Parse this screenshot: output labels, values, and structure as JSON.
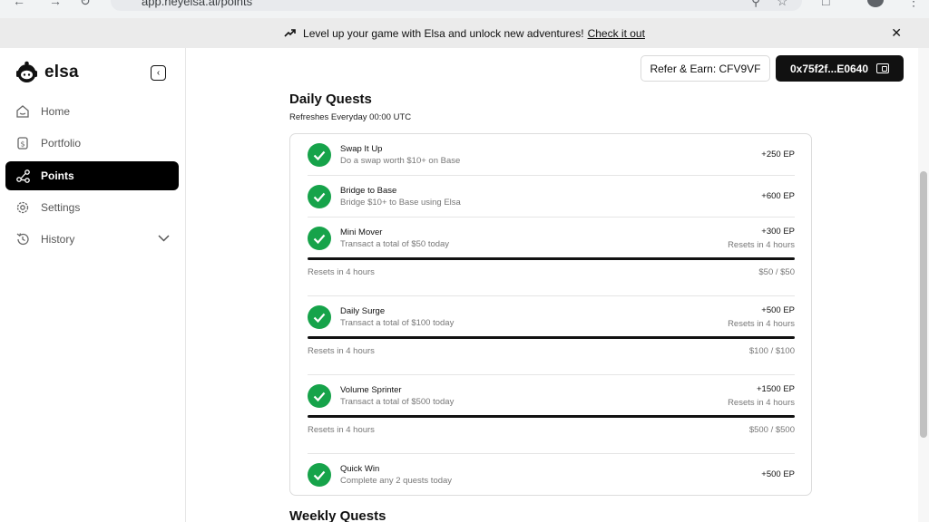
{
  "browser": {
    "url": "app.heyelsa.ai/points"
  },
  "banner": {
    "text": "Level up your game with Elsa and unlock new adventures!",
    "link": "Check it out",
    "close_icon": "close-icon"
  },
  "sidebar": {
    "brand": "elsa",
    "items": [
      {
        "label": "Home",
        "icon": "home-icon"
      },
      {
        "label": "Portfolio",
        "icon": "portfolio-icon"
      },
      {
        "label": "Points",
        "icon": "points-icon",
        "active": true
      },
      {
        "label": "Settings",
        "icon": "gear-icon"
      },
      {
        "label": "History",
        "icon": "history-icon"
      }
    ]
  },
  "header": {
    "refer": "Refer & Earn: CFV9VF",
    "wallet": "0x75f2f...E0640"
  },
  "daily": {
    "title": "Daily Quests",
    "subtitle": "Refreshes Everyday 00:00 UTC",
    "quests": [
      {
        "name": "Swap It Up",
        "desc": "Do a swap worth $10+ on Base",
        "points": "+250 EP"
      },
      {
        "name": "Bridge to Base",
        "desc": "Bridge $10+ to Base using Elsa",
        "points": "+600 EP"
      },
      {
        "name": "Mini Mover",
        "desc": "Transact a total of $50 today",
        "points": "+300 EP",
        "reset_right": "Resets in 4 hours",
        "reset_left": "Resets in 4 hours",
        "progress": "$50 / $50",
        "progress_fraction": 1.0
      },
      {
        "name": "Daily Surge",
        "desc": "Transact a total of $100 today",
        "points": "+500 EP",
        "reset_right": "Resets in 4 hours",
        "reset_left": "Resets in 4 hours",
        "progress": "$100 / $100",
        "progress_fraction": 1.0
      },
      {
        "name": "Volume Sprinter",
        "desc": "Transact a total of $500 today",
        "points": "+1500 EP",
        "reset_right": "Resets in 4 hours",
        "reset_left": "Resets in 4 hours",
        "progress": "$500 / $500",
        "progress_fraction": 1.0
      },
      {
        "name": "Quick Win",
        "desc": "Complete any 2 quests today",
        "points": "+500 EP"
      }
    ]
  },
  "weekly": {
    "title": "Weekly Quests"
  },
  "colors": {
    "accent": "#000000",
    "success": "#16a34a",
    "banner_bg": "#ebebeb"
  }
}
